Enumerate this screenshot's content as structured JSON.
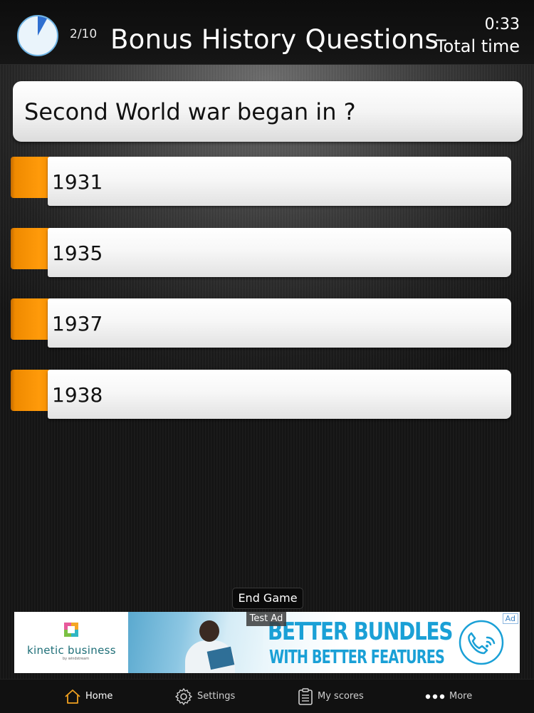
{
  "header": {
    "progress": "2/10",
    "title": "Bonus History Questions",
    "time_value": "0:33",
    "time_label": "Total time",
    "timer_fraction": 0.08
  },
  "question": {
    "text": "Second World war began in ?"
  },
  "answers": [
    {
      "label": "1931"
    },
    {
      "label": "1935"
    },
    {
      "label": "1937"
    },
    {
      "label": "1938"
    }
  ],
  "controls": {
    "end_game_label": "End Game"
  },
  "ad": {
    "test_label": "Test Ad",
    "badge": "Ad",
    "brand": "kinetic business",
    "brand_sub": "by windstream",
    "headline_1": "BETTER BUNDLES",
    "headline_2": "WITH BETTER FEATURES"
  },
  "tabbar": {
    "items": [
      {
        "label": "Home",
        "icon": "home-icon",
        "active": true
      },
      {
        "label": "Settings",
        "icon": "gear-icon",
        "active": false
      },
      {
        "label": "My scores",
        "icon": "clipboard-icon",
        "active": false
      },
      {
        "label": "More",
        "icon": "more-dots-icon",
        "active": false
      }
    ]
  },
  "colors": {
    "accent_orange": "#ff9a0a",
    "timer_blue": "#2f6fd0",
    "ad_blue": "#1aa0d6"
  }
}
